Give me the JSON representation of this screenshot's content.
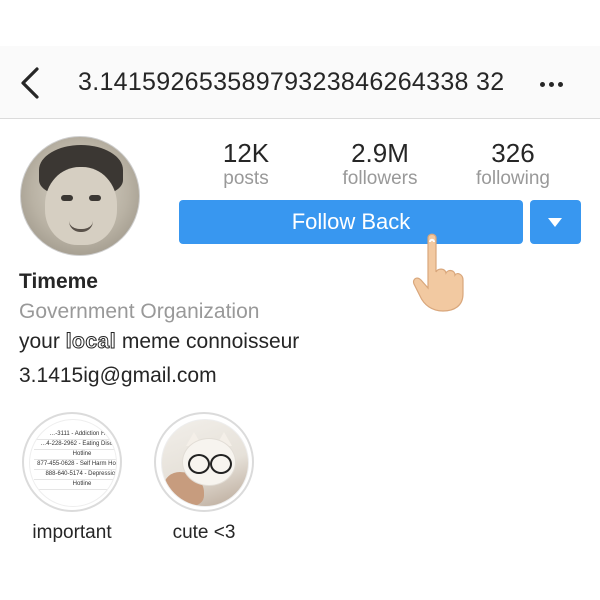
{
  "header": {
    "title": "3.14159265358979323846264338 32"
  },
  "profile": {
    "stats": {
      "posts": {
        "value": "12K",
        "label": "posts"
      },
      "followers": {
        "value": "2.9M",
        "label": "followers"
      },
      "following": {
        "value": "326",
        "label": "following"
      }
    },
    "follow_button_label": "Follow Back",
    "name": "Timeme",
    "category": "Government Organization",
    "bio_prefix": "your ",
    "bio_emphasis": "local",
    "bio_suffix": " meme connoisseur",
    "email": "3.1415ig@gmail.com"
  },
  "highlights": [
    {
      "label": "important",
      "cover_lines": [
        "…-3111 - Addiction Ho…",
        "…4-228-2962 - Eating Disorder",
        "Hotline",
        "877-455-0628 - Self Harm Hotline",
        "888-640-5174 - Depression",
        "Hotline"
      ]
    },
    {
      "label": "cute <3"
    }
  ],
  "colors": {
    "accent": "#3897f0",
    "muted_text": "#999999",
    "text": "#262626"
  }
}
